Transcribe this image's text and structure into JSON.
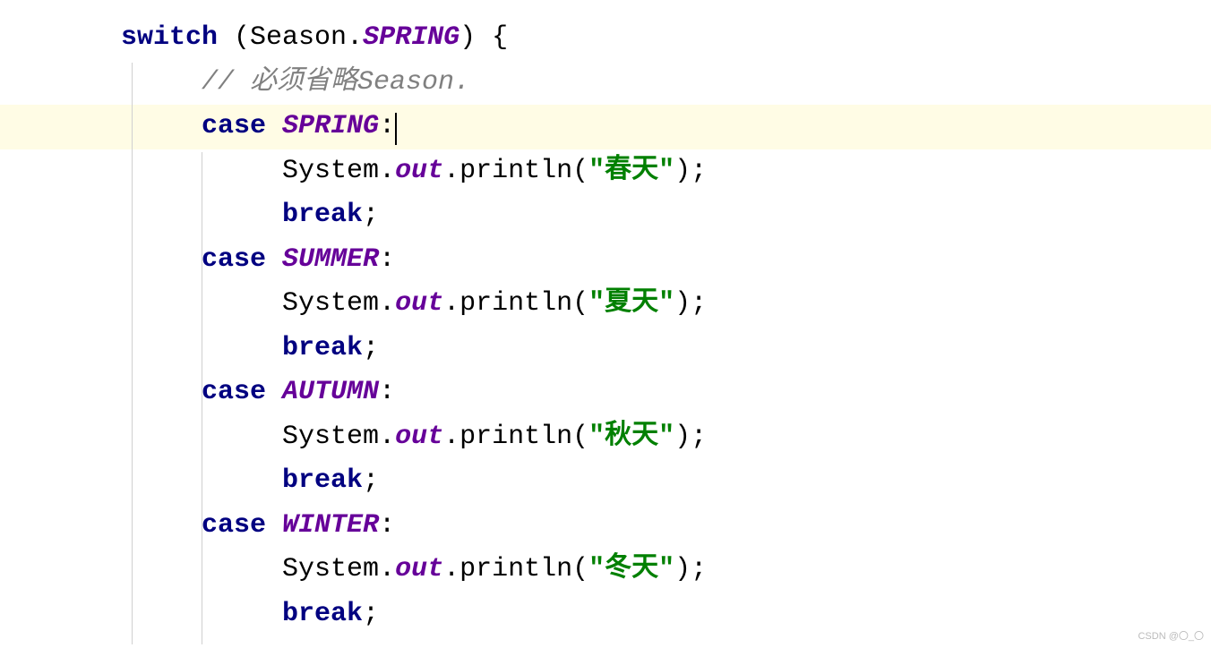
{
  "code": {
    "line1": {
      "switch_kw": "switch",
      "lparen": " (",
      "class_name": "Season",
      "dot": ".",
      "enum_val": "SPRING",
      "rparen": ")",
      "brace": " {"
    },
    "line2": {
      "comment": "// 必须省略Season."
    },
    "line3": {
      "case_kw": "case",
      "space": " ",
      "enum_val": "SPRING",
      "colon": ":"
    },
    "line4": {
      "sys": "System",
      "dot1": ".",
      "out": "out",
      "dot2": ".",
      "method": "println",
      "lparen": "(",
      "str": "\"春天\"",
      "rparen_semi": ");"
    },
    "line5": {
      "break_kw": "break",
      "semi": ";"
    },
    "line6": {
      "case_kw": "case",
      "space": " ",
      "enum_val": "SUMMER",
      "colon": ":"
    },
    "line7": {
      "sys": "System",
      "dot1": ".",
      "out": "out",
      "dot2": ".",
      "method": "println",
      "lparen": "(",
      "str": "\"夏天\"",
      "rparen_semi": ");"
    },
    "line8": {
      "break_kw": "break",
      "semi": ";"
    },
    "line9": {
      "case_kw": "case",
      "space": " ",
      "enum_val": "AUTUMN",
      "colon": ":"
    },
    "line10": {
      "sys": "System",
      "dot1": ".",
      "out": "out",
      "dot2": ".",
      "method": "println",
      "lparen": "(",
      "str": "\"秋天\"",
      "rparen_semi": ");"
    },
    "line11": {
      "break_kw": "break",
      "semi": ";"
    },
    "line12": {
      "case_kw": "case",
      "space": " ",
      "enum_val": "WINTER",
      "colon": ":"
    },
    "line13": {
      "sys": "System",
      "dot1": ".",
      "out": "out",
      "dot2": ".",
      "method": "println",
      "lparen": "(",
      "str": "\"冬天\"",
      "rparen_semi": ");"
    },
    "line14": {
      "break_kw": "break",
      "semi": ";"
    }
  },
  "watermark": "CSDN @〇_〇"
}
